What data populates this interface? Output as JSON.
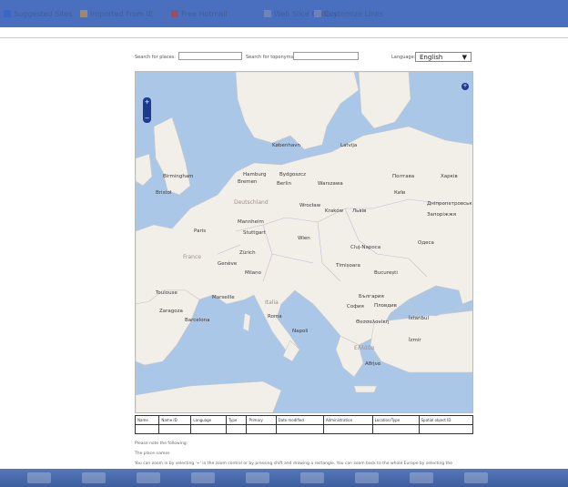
{
  "bookmarks": [
    {
      "label": "Suggested Sites",
      "icon": "ie-page-icon",
      "color": "#2e62c8"
    },
    {
      "label": "Imported From IE",
      "icon": "folder-icon",
      "color": "#e0a030"
    },
    {
      "label": "Free Hotmail",
      "icon": "msn-icon",
      "color": "#c83a2e"
    },
    {
      "label": "Web Slice Gallery",
      "icon": "page-icon",
      "color": "#8899bb"
    },
    {
      "label": "Customize Links",
      "icon": "page-icon",
      "color": "#8899bb"
    }
  ],
  "search": {
    "places_label": "Search for places:",
    "places_value": "",
    "toponyms_label": "Search for toponyms:",
    "toponyms_value": "",
    "language_label": "Language:",
    "language_value": "English",
    "language_arrow": "▼"
  },
  "map": {
    "zoom_in": "+",
    "zoom_out": "−",
    "layers_button": "+",
    "labels": {
      "kobenhavn": "København",
      "latvija": "Latvija",
      "hamburg": "Hamburg",
      "bremen": "Bremen",
      "berlin": "Berlin",
      "bydgoszcz": "Bydgoszcz",
      "warszawa": "Warszawa",
      "birmingham": "Birmingham",
      "bristol": "Bristol",
      "paris": "Paris",
      "deutschland": "Deutschland",
      "mannheim": "Mannheim",
      "stuttgart": "Stuttgart",
      "wroclaw": "Wrocław",
      "krakow": "Kraków",
      "lviv": "Львів",
      "kyiv": "Київ",
      "kharkiv": "Харків",
      "poltava": "Полтава",
      "dnipro": "Дніпропетровськ",
      "zaporizhzhia": "Запоріжжя",
      "wien": "Wien",
      "zurich": "Zürich",
      "geneve": "Genève",
      "milano": "Milano",
      "cluj": "Cluj-Napoca",
      "timisoara": "Timișoara",
      "bucuresti": "București",
      "france": "France",
      "toulouse": "Toulouse",
      "marseille": "Marseille",
      "zaragoza": "Zaragoza",
      "barcelona": "Barcelona",
      "roma": "Roma",
      "napoli": "Napoli",
      "sofia": "София",
      "balgaria": "България",
      "plovdiv": "Пловдив",
      "thessaloniki": "Θεσσαλονίκη",
      "istanbul": "İstanbul",
      "izmir": "İzmir",
      "ellada": "Ελλάδα",
      "athina": "Αθήνα",
      "italia": "Italia",
      "odesa": "Одеса"
    }
  },
  "table": {
    "headers": [
      "Name",
      "Name ID",
      "Language",
      "Type",
      "Primary",
      "Date modified",
      "Administration",
      "Location/Type",
      "Spatial object ID"
    ]
  },
  "notes": [
    "Please note the following:",
    "The place names ",
    "You can zoom in by selecting '+' in the zoom control or by pressing shift and drawing a rectangle. You can zoom back to the whole Europe by selecting the"
  ]
}
